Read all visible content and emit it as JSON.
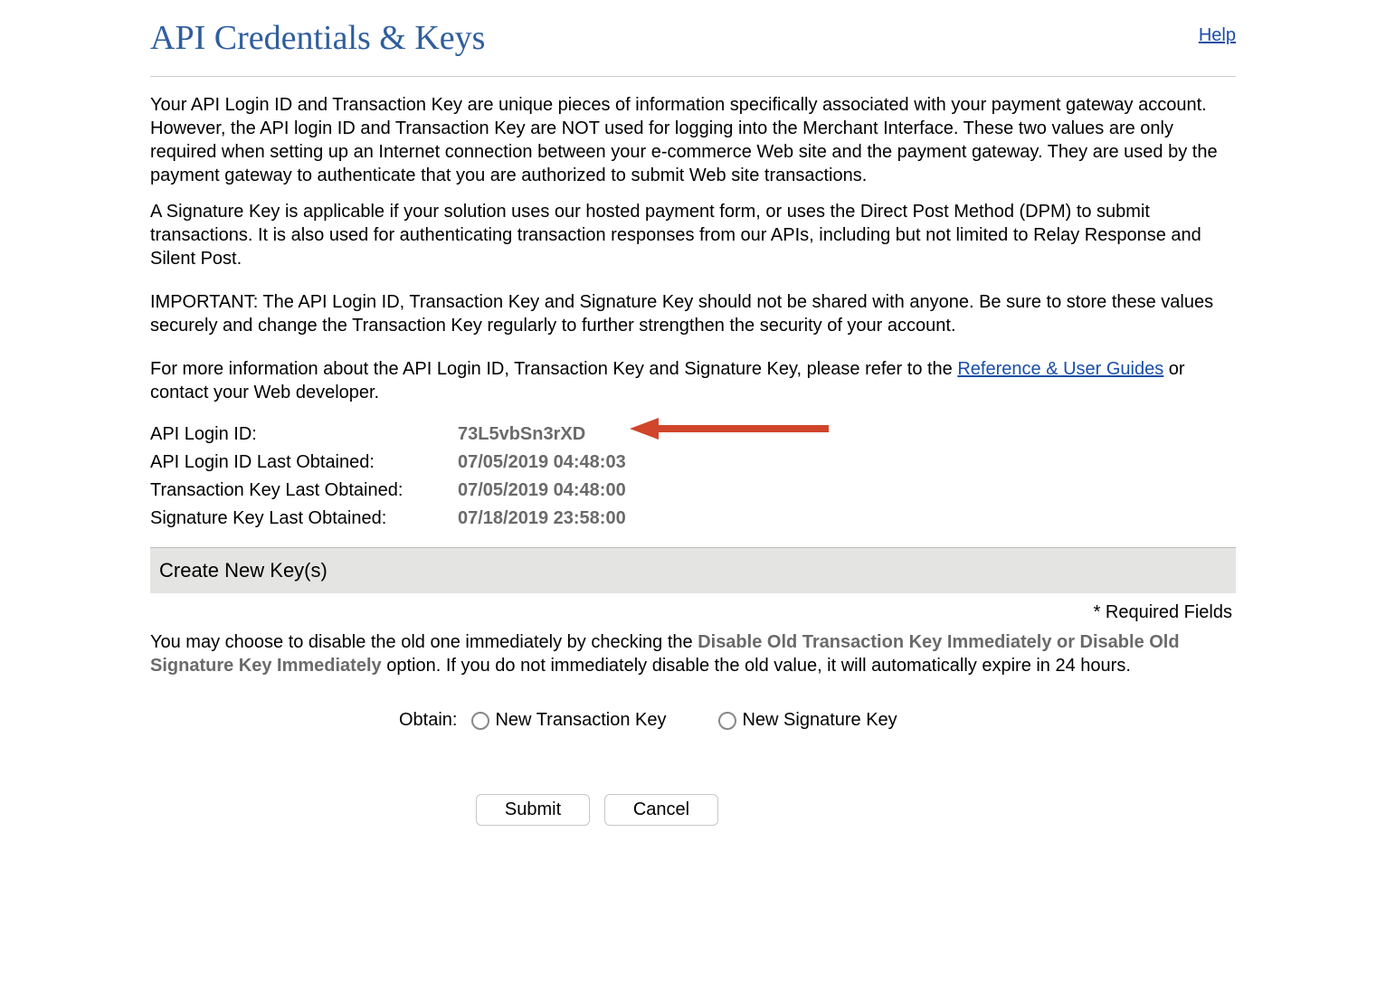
{
  "header": {
    "title": "API Credentials & Keys",
    "help_label": "Help"
  },
  "intro": {
    "para1": "Your API Login ID and Transaction Key are unique pieces of information specifically associated with your payment gateway account. However, the API login ID and Transaction Key are NOT used for logging into the Merchant Interface. These two values are only required when setting up an Internet connection between your e-commerce Web site and the payment gateway. They are used by the payment gateway to authenticate that you are authorized to submit Web site transactions.",
    "para2": "A Signature Key is applicable if your solution uses our hosted payment form, or uses the Direct Post Method (DPM) to submit transactions. It is also used for authenticating transaction responses from our APIs, including but not limited to Relay Response and Silent Post.",
    "important": "IMPORTANT: The API Login ID, Transaction Key and Signature Key should not be shared with anyone. Be sure to store these values securely and change the Transaction Key regularly to further strengthen the security of your account.",
    "ref_prefix": "For more information about the API Login ID, Transaction Key and Signature Key, please refer to the ",
    "ref_link": "Reference & User Guides",
    "ref_suffix": " or contact your Web developer."
  },
  "info": {
    "rows": [
      {
        "label": "API Login ID:",
        "value": "73L5vbSn3rXD"
      },
      {
        "label": "API Login ID Last Obtained:",
        "value": "07/05/2019 04:48:03"
      },
      {
        "label": "Transaction Key Last Obtained:",
        "value": "07/05/2019 04:48:00"
      },
      {
        "label": "Signature Key Last Obtained:",
        "value": "07/18/2019 23:58:00"
      }
    ]
  },
  "create": {
    "section_title": "Create New Key(s)",
    "required_note": "* Required Fields",
    "disable_prefix": "You may choose to disable the old one immediately by checking the ",
    "disable_bold": "Disable Old Transaction Key Immediately or Disable Old Signature Key Immediately",
    "disable_suffix": " option. If you do not immediately disable the old value, it will automatically expire in 24 hours.",
    "obtain_label": "Obtain:",
    "option_new_transaction": "New Transaction Key",
    "option_new_signature": "New Signature Key",
    "submit_label": "Submit",
    "cancel_label": "Cancel"
  },
  "annotation": {
    "arrow_color": "#d1452a"
  }
}
